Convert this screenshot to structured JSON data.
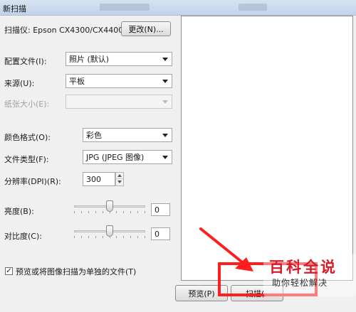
{
  "window": {
    "title": "新扫描"
  },
  "scanner": {
    "label": "扫描仪: Epson CX4300/CX4400/...",
    "change_button": "更改(N)..."
  },
  "fields": {
    "profile": {
      "label": "配置文件(I):",
      "value": "照片 (默认)"
    },
    "source": {
      "label": "来源(U):",
      "value": "平板"
    },
    "paper": {
      "label": "纸张大小(E):",
      "value": ""
    },
    "color": {
      "label": "颜色格式(O):",
      "value": "彩色"
    },
    "filetype": {
      "label": "文件类型(F):",
      "value": "JPG (JPEG 图像)"
    },
    "dpi": {
      "label": "分辨率(DPI)(R):",
      "value": "300"
    },
    "brightness": {
      "label": "亮度(B):",
      "value": "0",
      "level": 0.5
    },
    "contrast": {
      "label": "对比度(C):",
      "value": "0",
      "level": 0.5
    }
  },
  "separate_files": {
    "label": "预览或将图像扫描为单独的文件(T)",
    "checked": true,
    "mark": "✓"
  },
  "buttons": {
    "preview": "预览(P)",
    "scan": "扫描("
  },
  "watermark": {
    "brand": "百科全说",
    "tagline": "助你轻松解决"
  },
  "colors": {
    "annotation": "#ff1e1e",
    "watermark_red": "#d21d28"
  }
}
